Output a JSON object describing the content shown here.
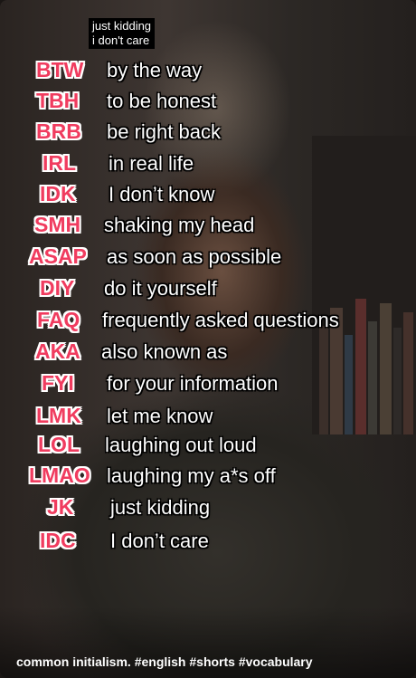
{
  "caption": {
    "line1": "just kidding",
    "line2": "i don't care"
  },
  "rows": [
    {
      "abbr": "BTW",
      "meaning": "by the way"
    },
    {
      "abbr": "TBH",
      "meaning": "to be honest"
    },
    {
      "abbr": "BRB",
      "meaning": "be right back"
    },
    {
      "abbr": "IRL",
      "meaning": "in real life"
    },
    {
      "abbr": "IDK",
      "meaning": "I don’t know"
    },
    {
      "abbr": "SMH",
      "meaning": "shaking my head"
    },
    {
      "abbr": "ASAP",
      "meaning": "as soon as possible"
    },
    {
      "abbr": "DIY",
      "meaning": "do it yourself"
    },
    {
      "abbr": "FAQ",
      "meaning": "frequently asked questions"
    },
    {
      "abbr": "AKA",
      "meaning": "also known as"
    },
    {
      "abbr": "FYI",
      "meaning": "for your information"
    },
    {
      "abbr": "LMK",
      "meaning": "let me know"
    },
    {
      "abbr": "LOL",
      "meaning": "laughing out loud"
    },
    {
      "abbr": "LMAO",
      "meaning": "laughing my a*s off"
    },
    {
      "abbr": "JK",
      "meaning": "just kidding"
    },
    {
      "abbr": "IDC",
      "meaning": "I don’t care"
    }
  ],
  "description": "common initialism. #english #shorts #vocabulary",
  "colors": {
    "abbr": "#f03c5f",
    "abbr_outline": "#ffffff",
    "meaning": "#ffffff"
  }
}
